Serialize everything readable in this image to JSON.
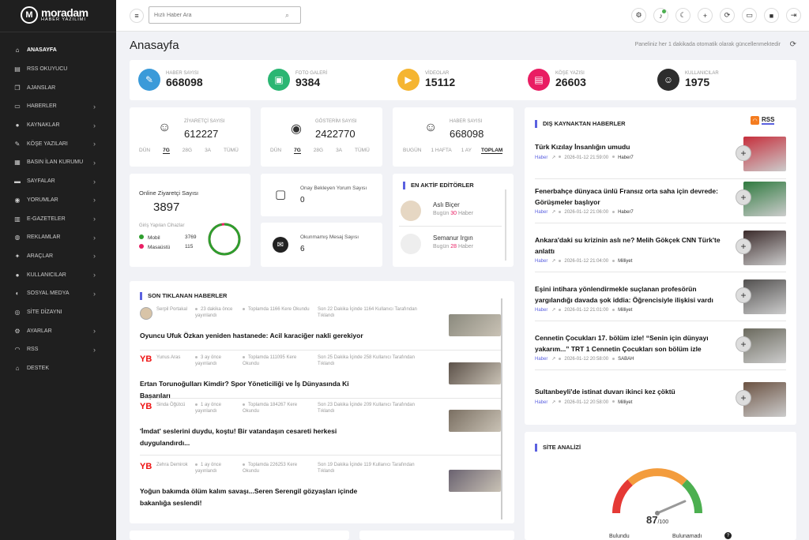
{
  "brand": {
    "name": "moradam",
    "sub": "HABER YAZILIMI"
  },
  "sidebar": {
    "items": [
      {
        "label": "ANASAYFA",
        "icon": "home-icon",
        "glyph": "⌂",
        "chevron": false,
        "active": true
      },
      {
        "label": "RSS OKUYUCU",
        "icon": "rss-icon",
        "glyph": "▤",
        "chevron": false
      },
      {
        "label": "AJANSLAR",
        "icon": "copy-icon",
        "glyph": "❐",
        "chevron": false
      },
      {
        "label": "HABERLER",
        "icon": "news-icon",
        "glyph": "▭",
        "chevron": true
      },
      {
        "label": "KAYNAKLAR",
        "icon": "users-icon",
        "glyph": "●",
        "chevron": true
      },
      {
        "label": "KÖŞE YAZILARI",
        "icon": "pen-icon",
        "glyph": "✎",
        "chevron": true
      },
      {
        "label": "BASIN İLAN KURUMU",
        "icon": "table-icon",
        "glyph": "▦",
        "chevron": true
      },
      {
        "label": "SAYFALAR",
        "icon": "pages-icon",
        "glyph": "▬",
        "chevron": true
      },
      {
        "label": "YORUMLAR",
        "icon": "comment-icon",
        "glyph": "◉",
        "chevron": true
      },
      {
        "label": "E-GAZETELER",
        "icon": "newspaper-icon",
        "glyph": "▥",
        "chevron": true
      },
      {
        "label": "REKLAMLAR",
        "icon": "ads-icon",
        "glyph": "◍",
        "chevron": true
      },
      {
        "label": "ARAÇLAR",
        "icon": "wrench-icon",
        "glyph": "✦",
        "chevron": true
      },
      {
        "label": "KULLANICILAR",
        "icon": "users-group-icon",
        "glyph": "●",
        "chevron": true
      },
      {
        "label": "SOSYAL MEDYA",
        "icon": "share-icon",
        "glyph": "◐",
        "chevron": true
      },
      {
        "label": "SİTE DİZAYNI",
        "icon": "design-icon",
        "glyph": "◎",
        "chevron": false
      },
      {
        "label": "AYARLAR",
        "icon": "gear-icon",
        "glyph": "⚙",
        "chevron": true
      },
      {
        "label": "RSS",
        "icon": "rss-feed-icon",
        "glyph": "◠",
        "chevron": true
      },
      {
        "label": "DESTEK",
        "icon": "support-icon",
        "glyph": "⌂",
        "chevron": false
      }
    ]
  },
  "topbar": {
    "search_placeholder": "Hızlı Haber Ara"
  },
  "page": {
    "title": "Anasayfa",
    "refresh_note": "Paneliniz her 1 dakikada otomatik olarak güncellenmektedir"
  },
  "stats": [
    {
      "label": "HABER SAYISI",
      "value": "668098",
      "color": "#3a9ad9",
      "icon": "edit-icon",
      "glyph": "✎"
    },
    {
      "label": "FOTO GALERİ",
      "value": "9384",
      "color": "#2bb673",
      "icon": "image-icon",
      "glyph": "▣"
    },
    {
      "label": "VİDEOLAR",
      "value": "15112",
      "color": "#f5b531",
      "icon": "video-icon",
      "glyph": "▶"
    },
    {
      "label": "KÖŞE YAZISI",
      "value": "26603",
      "color": "#e91e63",
      "icon": "document-icon",
      "glyph": "▤"
    },
    {
      "label": "KULLANICILAR",
      "value": "1975",
      "color": "#2d2d2d",
      "icon": "users-icon",
      "glyph": "☺"
    }
  ],
  "visitors": {
    "label": "ZİYARETÇİ SAYISI",
    "value": "612227",
    "periods": [
      "DÜN",
      "7G",
      "28G",
      "3A",
      "TÜMÜ"
    ]
  },
  "views": {
    "label": "GÖSTERİM SAYISI",
    "value": "2422770",
    "periods": [
      "DÜN",
      "7G",
      "28G",
      "3A",
      "TÜMÜ"
    ]
  },
  "news_count": {
    "label": "HABER SAYISI",
    "value": "668098",
    "periods": [
      "BUGÜN",
      "1 HAFTA",
      "1 AY",
      "TOPLAM"
    ]
  },
  "online": {
    "label": "Online Ziyaretçi Sayısı",
    "value": "3897",
    "devices_title": "Giriş Yapılan Cihazlar",
    "mobile_label": "Mobil",
    "mobile_value": "3769",
    "desktop_label": "Masaüstü",
    "desktop_value": "115",
    "mobile_share": 0.9705,
    "mobile_color": "#2e9e2e",
    "desktop_color": "#e91e63"
  },
  "pending": {
    "label": "Onay Bekleyen Yorum Sayısı",
    "value": "0"
  },
  "unread": {
    "label": "Okunmamış Mesaj Sayısı",
    "value": "6"
  },
  "editors": {
    "title": "EN AKTİF EDİTÖRLER",
    "items": [
      {
        "name": "Aslı Biçer",
        "prefix": "Bugün",
        "count": "30",
        "suffix": "Haber"
      },
      {
        "name": "Semanur Irgın",
        "prefix": "Bugün",
        "count": "28",
        "suffix": "Haber"
      }
    ]
  },
  "clicked": {
    "title": "SON TIKLANAN HABERLER",
    "items": [
      {
        "author": "Serpil Portakal",
        "time": "23 dakika önce yayınlandı",
        "reads": "Toplamda 1166 Kere Okundu",
        "trend": "Son 22 Dakika İçinde 1164 Kullanıcı Tarafından Tıklandı",
        "title": "Oyuncu Ufuk Özkan yeniden hastanede: Acil karaciğer nakli gerekiyor",
        "logo": ""
      },
      {
        "author": "Yunus Aras",
        "time": "3 ay önce yayınlandı",
        "reads": "Toplamda 111095 Kere Okundu",
        "trend": "Son 25 Dakika İçinde 258 Kullanıcı Tarafından Tıklandı",
        "title": "Ertan Torunoğulları Kimdir? Spor Yöneticiliği ve İş Dünyasında Ki Başarıları",
        "logo": "YB"
      },
      {
        "author": "Sinda Öğütcü",
        "time": "1 ay önce yayınlandı",
        "reads": "Toplamda 184267 Kere Okundu",
        "trend": "Son 23 Dakika İçinde 209 Kullanıcı Tarafından Tıklandı",
        "title": "'İmdat' seslerini duydu, koştu! Bir vatandaşın cesareti herkesi duygulandırdı...",
        "logo": "YB"
      },
      {
        "author": "Zehra Demirok",
        "time": "1 ay önce yayınlandı",
        "reads": "Toplamda 226253 Kere Okundu",
        "trend": "Son 19 Dakika İçinde 119 Kullanıcı Tarafından Tıklandı",
        "title": "Yoğun bakımda ölüm kalım savaşı...Seren Serengil gözyaşları içinde bakanlığa seslendi!",
        "logo": "YB"
      }
    ]
  },
  "external": {
    "title": "DIŞ KAYNAKTAN HABERLER",
    "rss_label": "RSS",
    "items": [
      {
        "title": "Türk Kızılay İnsanlığın umudu",
        "cat": "Haber",
        "date": "2026-01-12 21:59:00",
        "source": "Haber7"
      },
      {
        "title": "Fenerbahçe dünyaca ünlü Fransız orta saha için devrede: Görüşmeler başlıyor",
        "cat": "Haber",
        "date": "2026-01-12 21:06:00",
        "source": "Haber7"
      },
      {
        "title": "Ankara'daki su krizinin aslı ne? Melih Gökçek CNN Türk'te anlattı",
        "cat": "Haber",
        "date": "2026-01-12 21:04:00",
        "source": "Milliyet"
      },
      {
        "title": "Eşini intihara yönlendirmekle suçlanan profesörün yargılandığı davada şok iddia: Öğrencisiyle ilişkisi vardı",
        "cat": "Haber",
        "date": "2026-01-12 21:01:00",
        "source": "Milliyet"
      },
      {
        "title": "Cennetin Çocukları 17. bölüm izle! “Senin için dünyayı yakarım...” TRT 1 Cennetin Çocukları son bölüm izle",
        "cat": "Haber",
        "date": "2026-01-12 20:58:00",
        "source": "SABAH"
      },
      {
        "title": "Sultanbeyli'de istinat duvarı ikinci kez çöktü",
        "cat": "Haber",
        "date": "2026-01-12 20:58:00",
        "source": "Milliyet"
      }
    ]
  },
  "analysis": {
    "title": "SİTE ANALİZİ",
    "score": "87",
    "max": "/100",
    "score_value": 87,
    "found_label": "Bulundu",
    "notfound_label": "Bulunamadı"
  }
}
